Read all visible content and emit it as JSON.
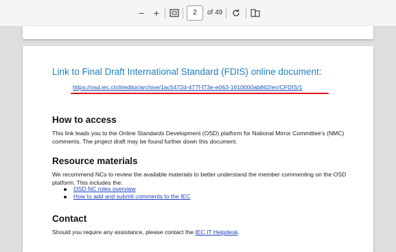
{
  "toolbar": {
    "zoom_out_icon": "minus-icon",
    "zoom_in_icon": "plus-icon",
    "fit_icon": "fit-page-icon",
    "page_current": "2",
    "page_total_label": "of 49",
    "rotate_icon": "rotate-icon",
    "two_page_icon": "two-page-icon"
  },
  "document": {
    "heading_link": "Link to Final Draft International Standard (FDIS) online document:",
    "link_url": "https://osd.iec.ch/#/editor/archive/1ac5472d-477f-f73e-e063-1610000ab862/en/CFDIS/1",
    "highlight_color": "#e0141e",
    "sections": {
      "access_title": "How to access",
      "access_text": "This link leads you to the Online Standards Development (OSD) platform for National Mirror Committee’s (NMC) comments. The project draft may be found further down this document.",
      "resource_title": "Resource materials",
      "resource_text": "We recommend NCs to review the available materials to better understand the member commenting on the OSD platform. This includes the:",
      "resource_links": [
        "OSD NC roles overview",
        "How to add and submit comments to the IEC"
      ],
      "contact_title": "Contact",
      "contact_text": "Should you require any assistance, please contact the ",
      "contact_link": "IEC IT Helpdesk",
      "contact_suffix": "."
    }
  }
}
